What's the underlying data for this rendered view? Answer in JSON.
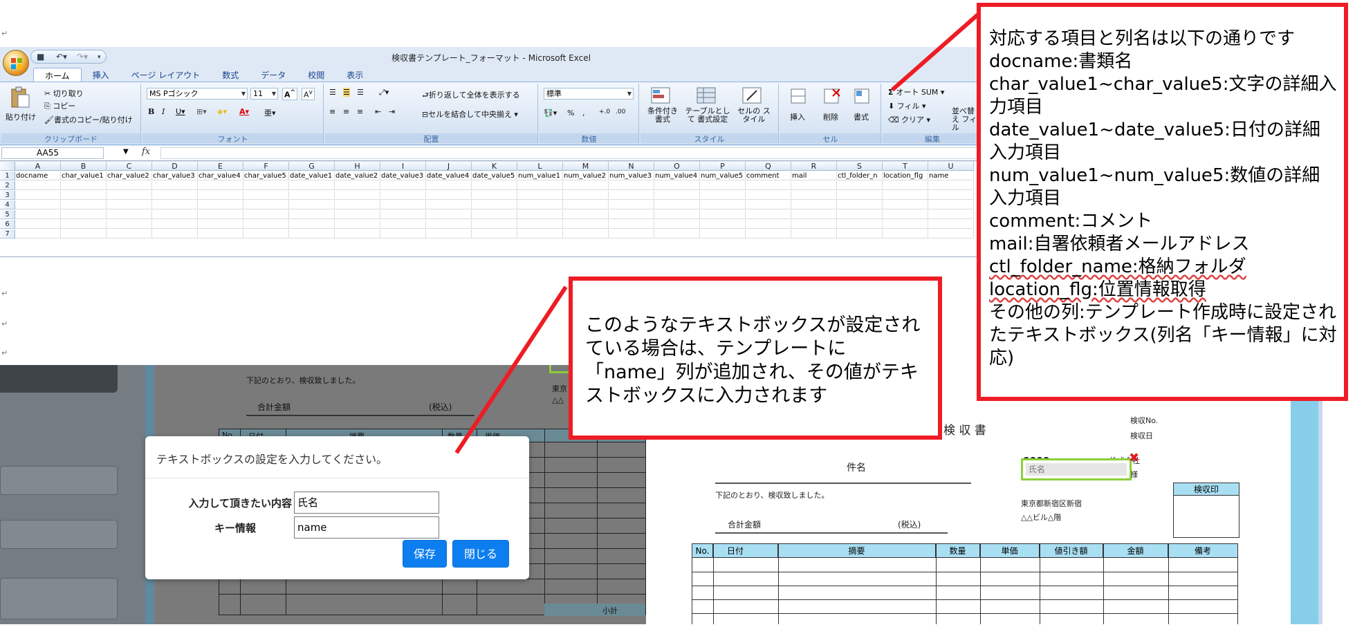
{
  "excel": {
    "window_title": "検収書テンプレート_フォーマット - Microsoft Excel",
    "tabs": [
      "ホーム",
      "挿入",
      "ページ レイアウト",
      "数式",
      "データ",
      "校閲",
      "表示"
    ],
    "clipboard": {
      "paste": "貼り付け",
      "cut": "切り取り",
      "copy": "コピー",
      "format_painter": "書式のコピー/貼り付け",
      "label": "クリップボード"
    },
    "font": {
      "name": "MS Pゴシック",
      "size": "11",
      "label": "フォント"
    },
    "alignment": {
      "wrap": "折り返して全体を表示する",
      "merge": "セルを結合して中央揃え",
      "label": "配置"
    },
    "number": {
      "format": "標準",
      "label": "数値"
    },
    "styles": {
      "conditional": "条件付き 書式",
      "table": "テーブルとして 書式設定",
      "cell": "セルの スタイル",
      "label": "スタイル"
    },
    "cells": {
      "insert": "挿入",
      "delete": "削除",
      "format": "書式",
      "label": "セル"
    },
    "editing": {
      "autosum": "オート SUM",
      "fill": "フィル",
      "clear": "クリア",
      "sort": "並べ替え フィル",
      "label": "編集"
    },
    "namebox": "AA55",
    "fx": "fx",
    "columns": [
      "A",
      "B",
      "C",
      "D",
      "E",
      "F",
      "G",
      "H",
      "I",
      "J",
      "K",
      "L",
      "M",
      "N",
      "O",
      "P",
      "Q",
      "R",
      "S",
      "T",
      "U"
    ],
    "rows": [
      "1",
      "2",
      "3",
      "4",
      "5",
      "6",
      "7"
    ],
    "row1": [
      "docname",
      "char_value1",
      "char_value2",
      "char_value3",
      "char_value4",
      "char_value5",
      "date_value1",
      "date_value2",
      "date_value3",
      "date_value4",
      "date_value5",
      "num_value1",
      "num_value2",
      "num_value3",
      "num_value4",
      "num_value5",
      "comment",
      "mail",
      "ctl_folder_n",
      "location_flg",
      "name"
    ]
  },
  "callout1": {
    "lines": [
      "対応する項目と列名は以下の通りです",
      "docname:書類名",
      "char_value1~char_value5:文字の詳細入力項目",
      "date_value1~date_value5:日付の詳細入力項目",
      "num_value1~num_value5:数値の詳細入力項目",
      "comment:コメント",
      "mail:自署依頼者メールアドレス",
      "ctl_folder_name:格納フォルダ",
      "location_flg:位置情報取得",
      "その他の列:テンプレート作成時に設定されたテキストボックス(列名「キー情報」に対応)"
    ]
  },
  "callout2": {
    "text": "このようなテキストボックスが設定されている場合は、テンプレートに「name」列が追加され、その値がテキストボックスに入力されます"
  },
  "dialog": {
    "title": "テキストボックスの設定を入力してください。",
    "label_content": "入力して頂きたい内容",
    "value_content": "氏名",
    "label_key": "キー情報",
    "value_key": "name",
    "save": "保存",
    "close": "閉じる"
  },
  "left_doc": {
    "received": "下記のとおり、検収致しました。",
    "total": "合計金額",
    "tax": "(税込)",
    "tokyo": "東京",
    "triangles": "△△",
    "no": "No.",
    "date": "日付",
    "summary": "摘要",
    "quantity": "数量",
    "unit_price": "単価",
    "subtotal": "小計"
  },
  "right_doc": {
    "title": "検 収 書",
    "receipt_no": "検収No.",
    "receipt_date": "検収日",
    "subject": "件名",
    "company": "●●●●",
    "company_suffix": "株式会社",
    "sama": "様",
    "textbox_value": "氏名",
    "received": "下記のとおり、検収致しました。",
    "address1": "東京都新宿区新宿",
    "address2": "△△ビル△階",
    "seal": "検収印",
    "total": "合計金額",
    "tax": "(税込)",
    "headers": [
      "No.",
      "日付",
      "摘要",
      "数量",
      "単価",
      "値引き額",
      "金額",
      "備考"
    ]
  },
  "colors": {
    "callout_border": "#ee1c24",
    "button": "#0d7ef0",
    "table_header": "#a9dff3",
    "textbox_border": "#8ccf3b"
  }
}
